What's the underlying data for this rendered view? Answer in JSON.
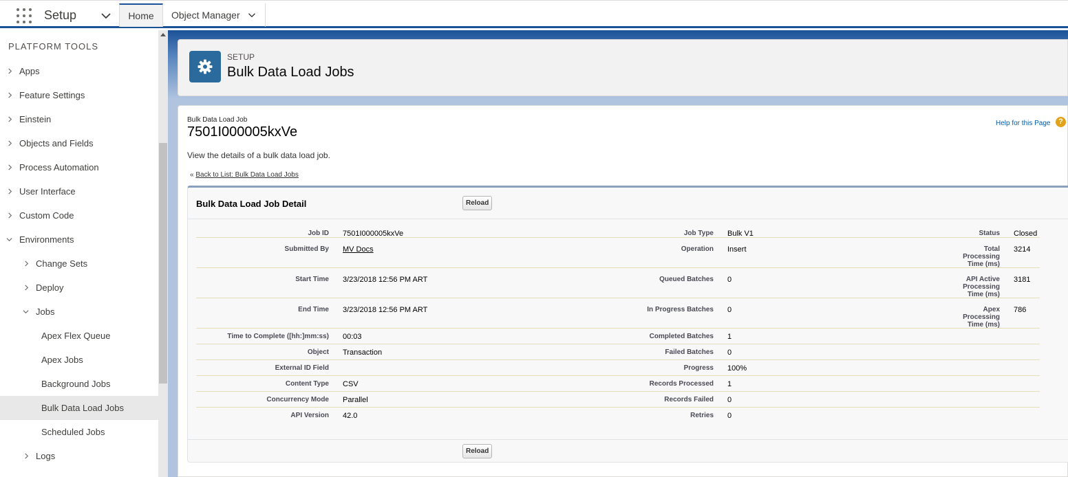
{
  "topnav": {
    "app_name": "Setup",
    "tabs": [
      {
        "label": "Home"
      },
      {
        "label": "Object Manager"
      }
    ]
  },
  "sidebar": {
    "section": "PLATFORM TOOLS",
    "items": [
      {
        "label": "Apps"
      },
      {
        "label": "Feature Settings"
      },
      {
        "label": "Einstein"
      },
      {
        "label": "Objects and Fields"
      },
      {
        "label": "Process Automation"
      },
      {
        "label": "User Interface"
      },
      {
        "label": "Custom Code"
      },
      {
        "label": "Environments"
      },
      {
        "label": "Change Sets"
      },
      {
        "label": "Deploy"
      },
      {
        "label": "Jobs"
      },
      {
        "label": "Apex Flex Queue"
      },
      {
        "label": "Apex Jobs"
      },
      {
        "label": "Background Jobs"
      },
      {
        "label": "Bulk Data Load Jobs"
      },
      {
        "label": "Scheduled Jobs"
      },
      {
        "label": "Logs"
      }
    ]
  },
  "header": {
    "eyebrow": "SETUP",
    "title": "Bulk Data Load Jobs"
  },
  "content": {
    "small_title": "Bulk Data Load Job",
    "job_id": "7501I000005kxVe",
    "help_link": "Help for this Page",
    "description": "View the details of a bulk data load job.",
    "back_prefix": "«",
    "back_link": "Back to List: Bulk Data Load Jobs"
  },
  "detail": {
    "title": "Bulk Data Load Job Detail",
    "reload_label": "Reload",
    "rows": [
      {
        "l1": "Job ID",
        "v1": "7501I000005kxVe",
        "l2": "Job Type",
        "v2": "Bulk V1",
        "l3": "Status",
        "v3": "Closed"
      },
      {
        "l1": "Submitted By",
        "v1": "MV Docs",
        "l2": "Operation",
        "v2": "Insert",
        "l3": "Total Processing Time (ms)",
        "v3": "3214"
      },
      {
        "l1": "Start Time",
        "v1": "3/23/2018 12:56 PM ART",
        "l2": "Queued Batches",
        "v2": "0",
        "l3": "API Active Processing Time (ms)",
        "v3": "3181"
      },
      {
        "l1": "End Time",
        "v1": "3/23/2018 12:56 PM ART",
        "l2": "In Progress Batches",
        "v2": "0",
        "l3": "Apex Processing Time (ms)",
        "v3": "786"
      },
      {
        "l1": "Time to Complete ([hh:]mm:ss)",
        "v1": "00:03",
        "l2": "Completed Batches",
        "v2": "1"
      },
      {
        "l1": "Object",
        "v1": "Transaction",
        "l2": "Failed Batches",
        "v2": "0"
      },
      {
        "l1": "External ID Field",
        "v1": "",
        "l2": "Progress",
        "v2": "100%"
      },
      {
        "l1": "Content Type",
        "v1": "CSV",
        "l2": "Records Processed",
        "v2": "1"
      },
      {
        "l1": "Concurrency Mode",
        "v1": "Parallel",
        "l2": "Records Failed",
        "v2": "0"
      },
      {
        "l1": "API Version",
        "v1": "42.0",
        "l2": "Retries",
        "v2": "0"
      }
    ]
  }
}
